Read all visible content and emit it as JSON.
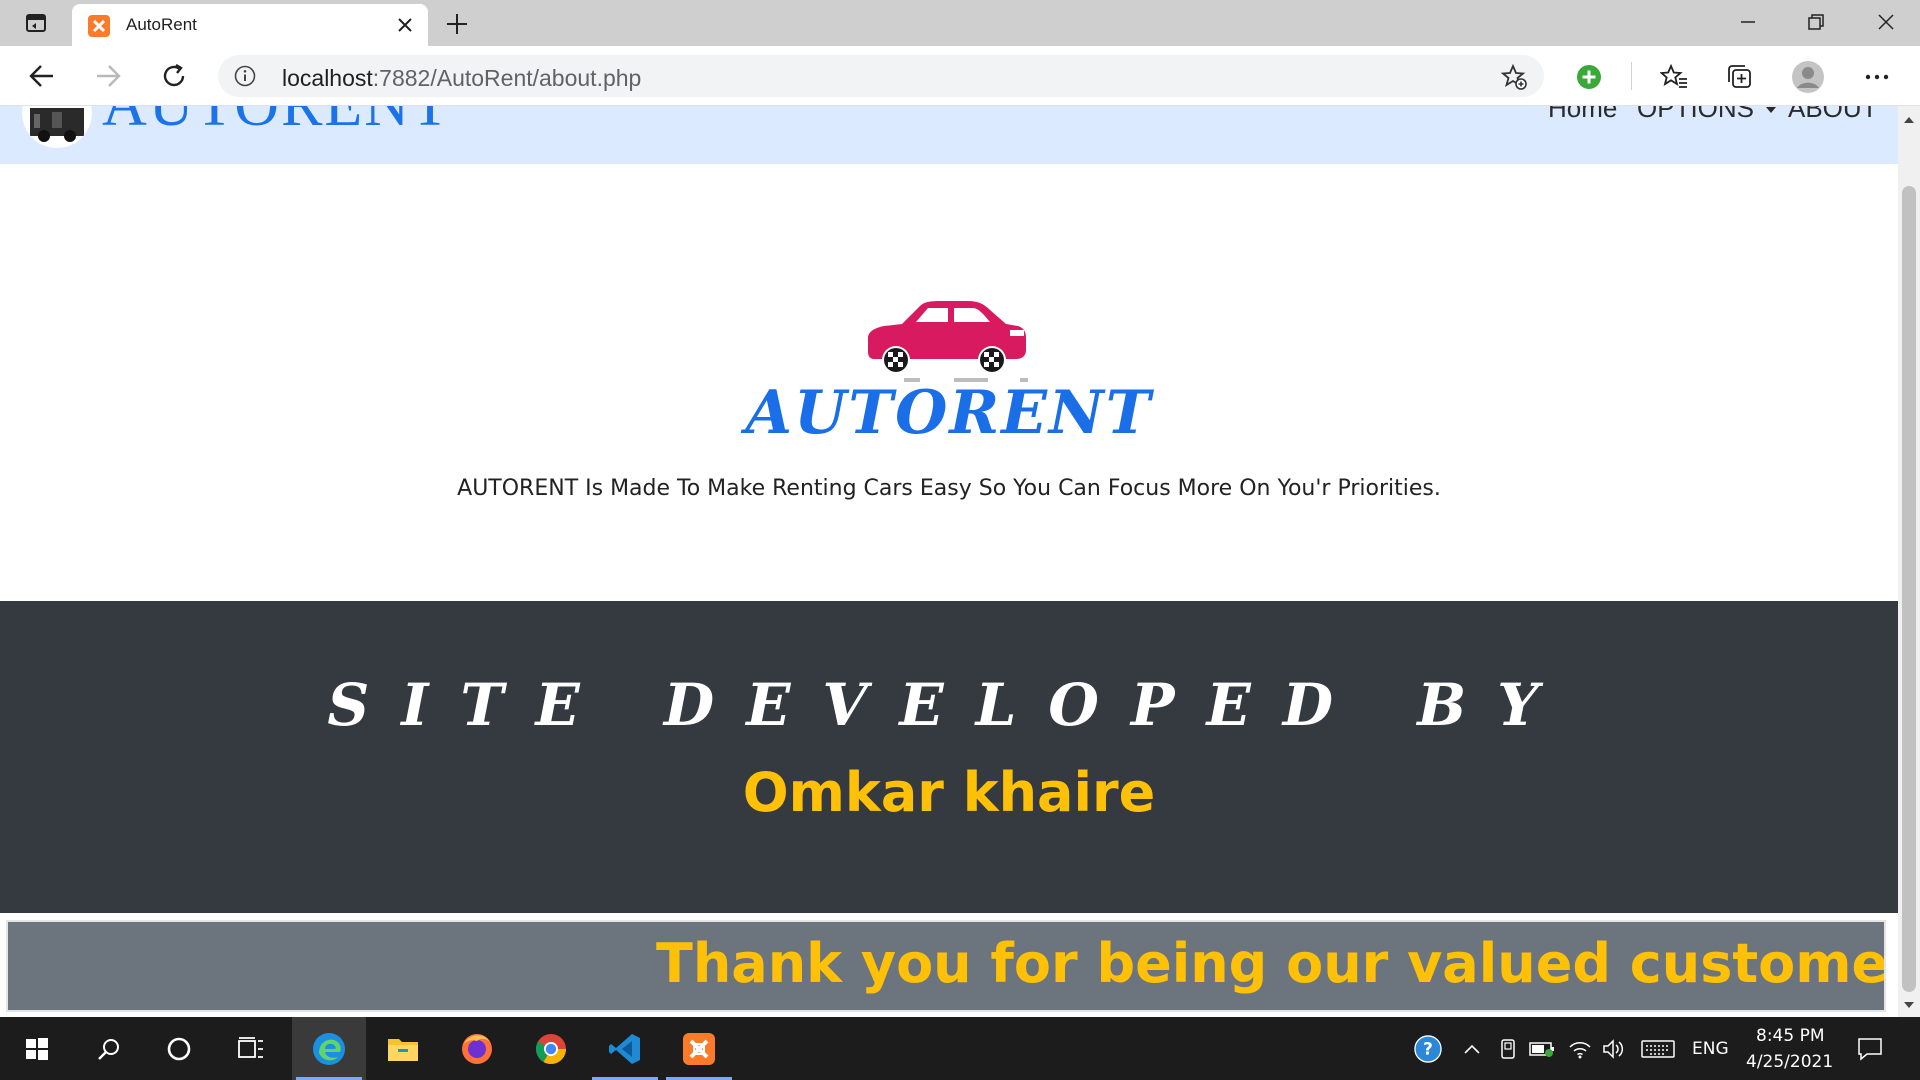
{
  "browser": {
    "tab_title": "AutoRent",
    "url_host": "localhost",
    "url_path": ":7882/AutoRent/about.php"
  },
  "site": {
    "brand": "AUTORENT",
    "menu": [
      "Home",
      "OPTIONS",
      "ABOUT"
    ],
    "hero_brand": "AUTORENT",
    "tagline": "AUTORENT Is Made To Make Renting Cars Easy So You Can Focus More On You'r Priorities.",
    "dev_heading": "SITE DEVELOPED BY",
    "dev_name": "Omkar khaire",
    "thanks": "Thank you for being our valued customer",
    "colors": {
      "nav_bg": "#dbeafe",
      "brand_blue": "#1a6ee8",
      "car_red": "#d81b60",
      "dark_section": "#343a40",
      "accent_yellow": "#ffc107",
      "marquee_bg": "#6c757d"
    }
  },
  "taskbar": {
    "language": "ENG",
    "time": "8:45 PM",
    "date": "4/25/2021",
    "pinned": [
      "edge-icon",
      "file-explorer-icon",
      "firefox-icon",
      "chrome-icon",
      "vscode-icon",
      "xampp-icon"
    ]
  }
}
